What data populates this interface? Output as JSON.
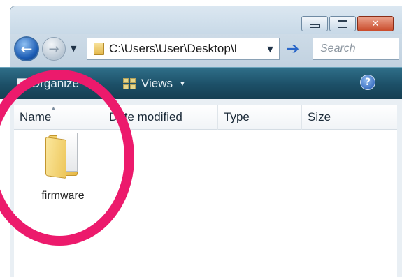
{
  "window": {
    "caption_buttons": {
      "minimize": "minimize-icon",
      "maximize": "maximize-icon",
      "close_glyph": "✕"
    }
  },
  "navigation": {
    "back_glyph": "←",
    "forward_glyph": "→",
    "recent_dropdown_glyph": "▼",
    "address": "C:\\Users\\User\\Desktop\\I",
    "address_dropdown_glyph": "▼",
    "go_glyph": "➔",
    "search_placeholder": "Search"
  },
  "toolbar": {
    "organize_label": "Organize",
    "organize_arrow": "▼",
    "views_label": "Views",
    "views_arrow": "▼",
    "help_glyph": "?"
  },
  "columns": {
    "name": "Name",
    "date_modified": "Date modified",
    "type": "Type",
    "size": "Size",
    "sort_glyph": "▲"
  },
  "items": [
    {
      "name": "firmware",
      "icon": "folder-icon"
    }
  ],
  "colors": {
    "highlight_ring": "#ec1a6c",
    "toolbar": "#1c4f67"
  }
}
